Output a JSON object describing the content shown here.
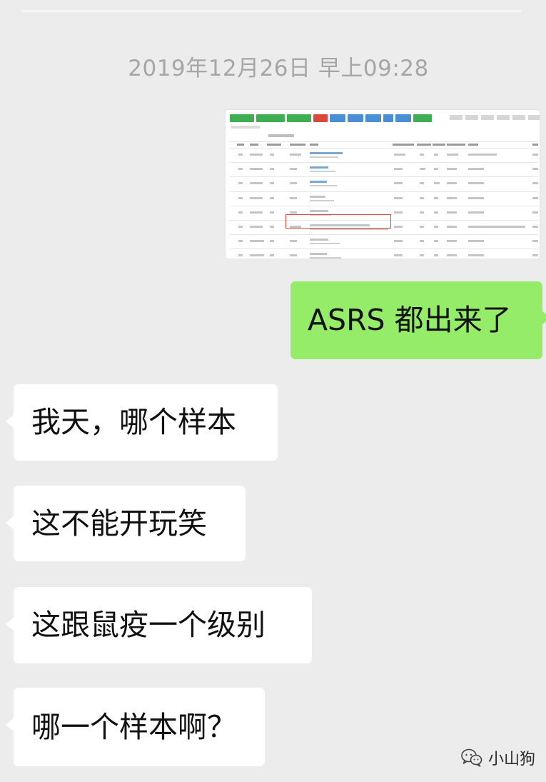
{
  "chat": {
    "timestamp": "2019年12月26日 早上09:28",
    "messages": [
      {
        "side": "right",
        "type": "image",
        "alt": "screenshot-of-table"
      },
      {
        "side": "right",
        "type": "text",
        "text": "ASRS 都出来了"
      },
      {
        "side": "left",
        "type": "text",
        "text": "我天，哪个样本"
      },
      {
        "side": "left",
        "type": "text",
        "text": "这不能开玩笑"
      },
      {
        "side": "left",
        "type": "text",
        "text": "这跟鼠疫一个级别"
      },
      {
        "side": "left",
        "type": "text",
        "text": "哪一个样本啊？"
      }
    ]
  },
  "watermark": {
    "text": "小山狗",
    "icon": "wechat-icon"
  },
  "colors": {
    "background": "#ececec",
    "sent_bubble": "#95ec69",
    "received_bubble": "#ffffff",
    "timestamp_text": "#a6a6a6",
    "highlight_box": "#d9483b"
  }
}
